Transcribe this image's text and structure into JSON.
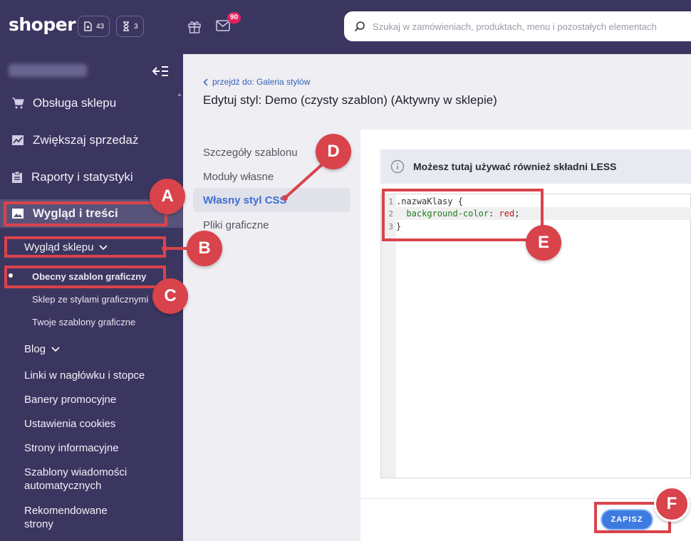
{
  "topbar": {
    "logo": "shoper",
    "counter_orders": "43",
    "counter_pending": "3",
    "notifications_count": "90",
    "search_placeholder": "Szukaj w zamówieniach, produktach, menu i pozostałych elementach"
  },
  "sidebar": {
    "items": [
      {
        "label": "Obsługa sklepu",
        "icon": "cart-icon"
      },
      {
        "label": "Zwiększaj sprzedaż",
        "icon": "trend-chart-icon"
      },
      {
        "label": "Raporty i statystyki",
        "icon": "clipboard-icon"
      },
      {
        "label": "Wygląd i treści",
        "icon": "image-icon"
      }
    ],
    "sub": {
      "appearance": "Wygląd sklepu",
      "current_template": "Obecny szablon graficzny",
      "styles_shop": "Sklep ze stylami graficznymi",
      "your_templates": "Twoje szablony graficzne",
      "blog": "Blog",
      "links": "Linki w nagłówku i stopce",
      "banners": "Banery promocyjne",
      "cookies": "Ustawienia cookies",
      "info_pages": "Strony informacyjne",
      "auto_messages_1": "Szablony wiadomości",
      "auto_messages_2": "automatycznych",
      "recommended_1": "Rekomendowane",
      "recommended_2": "strony"
    }
  },
  "main": {
    "back_link": "przejdź do: Galeria stylów",
    "title": "Edytuj styl: Demo (czysty szablon) (Aktywny w sklepie)",
    "tabs": [
      "Szczegóły szablonu",
      "Moduły własne",
      "Własny styl CSS",
      "Pliki graficzne"
    ],
    "info": "Możesz tutaj używać również składni LESS",
    "code": {
      "line1_selector": ".nazwaKlasy {",
      "line2_property": "background-color",
      "line2_colon": ": ",
      "line2_value": "red",
      "line2_semicolon": ";",
      "line3": "}",
      "line_numbers": [
        "1",
        "2",
        "3"
      ]
    },
    "save_label": "ZAPISZ"
  },
  "annotations": [
    "A",
    "B",
    "C",
    "D",
    "E",
    "F"
  ],
  "colors": {
    "sidebar_bg": "#3b3660",
    "accent_blue": "#3d7be0",
    "annotation_red": "#d9434b"
  }
}
